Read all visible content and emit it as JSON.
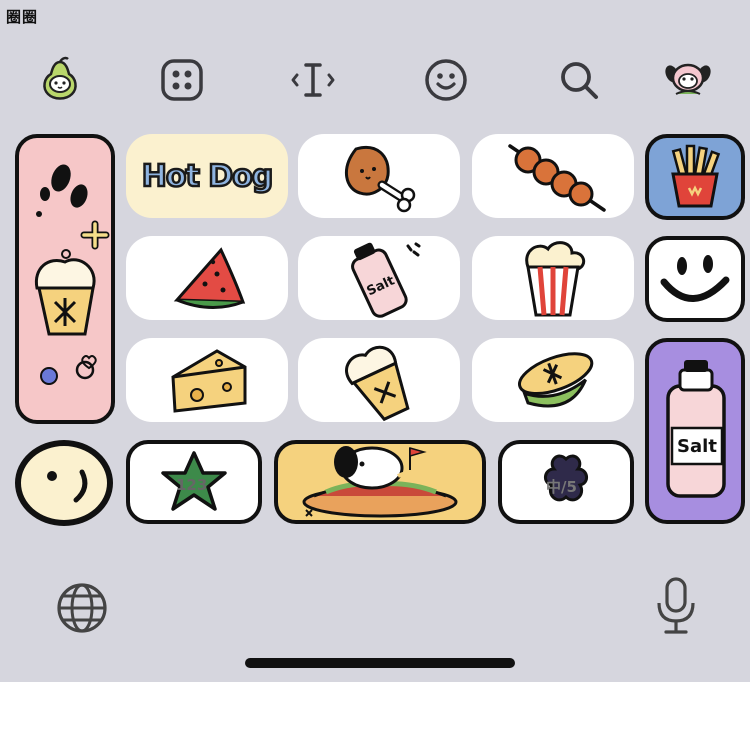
{
  "watermark": "圈圈",
  "toolbar": {
    "items": [
      {
        "name": "sticker-avatar-pear",
        "icon": "pear-character-icon"
      },
      {
        "name": "apps-button",
        "icon": "grid-icon"
      },
      {
        "name": "cursor-button",
        "icon": "text-cursor-icon"
      },
      {
        "name": "emoji-button",
        "icon": "smiley-icon"
      },
      {
        "name": "search-button",
        "icon": "search-icon"
      },
      {
        "name": "sticker-avatar-puppy",
        "icon": "puppy-character-icon"
      }
    ]
  },
  "keys": {
    "hotdog_text": "Hot Dog",
    "salt_small": "Salt",
    "salt_large": "Salt",
    "numbers_label": "123",
    "pinyin_label": "中/5"
  },
  "bottom": {
    "globe_icon": "globe-icon",
    "mic_icon": "microphone-icon"
  },
  "colors": {
    "background": "#d6d6de",
    "pink_key": "#f6c7c8",
    "cream_key": "#fbf1cf",
    "blue_key": "#7ea3d6",
    "purple_key": "#a78ee0",
    "yellow_key": "#f5d27e",
    "outline": "#111111"
  }
}
